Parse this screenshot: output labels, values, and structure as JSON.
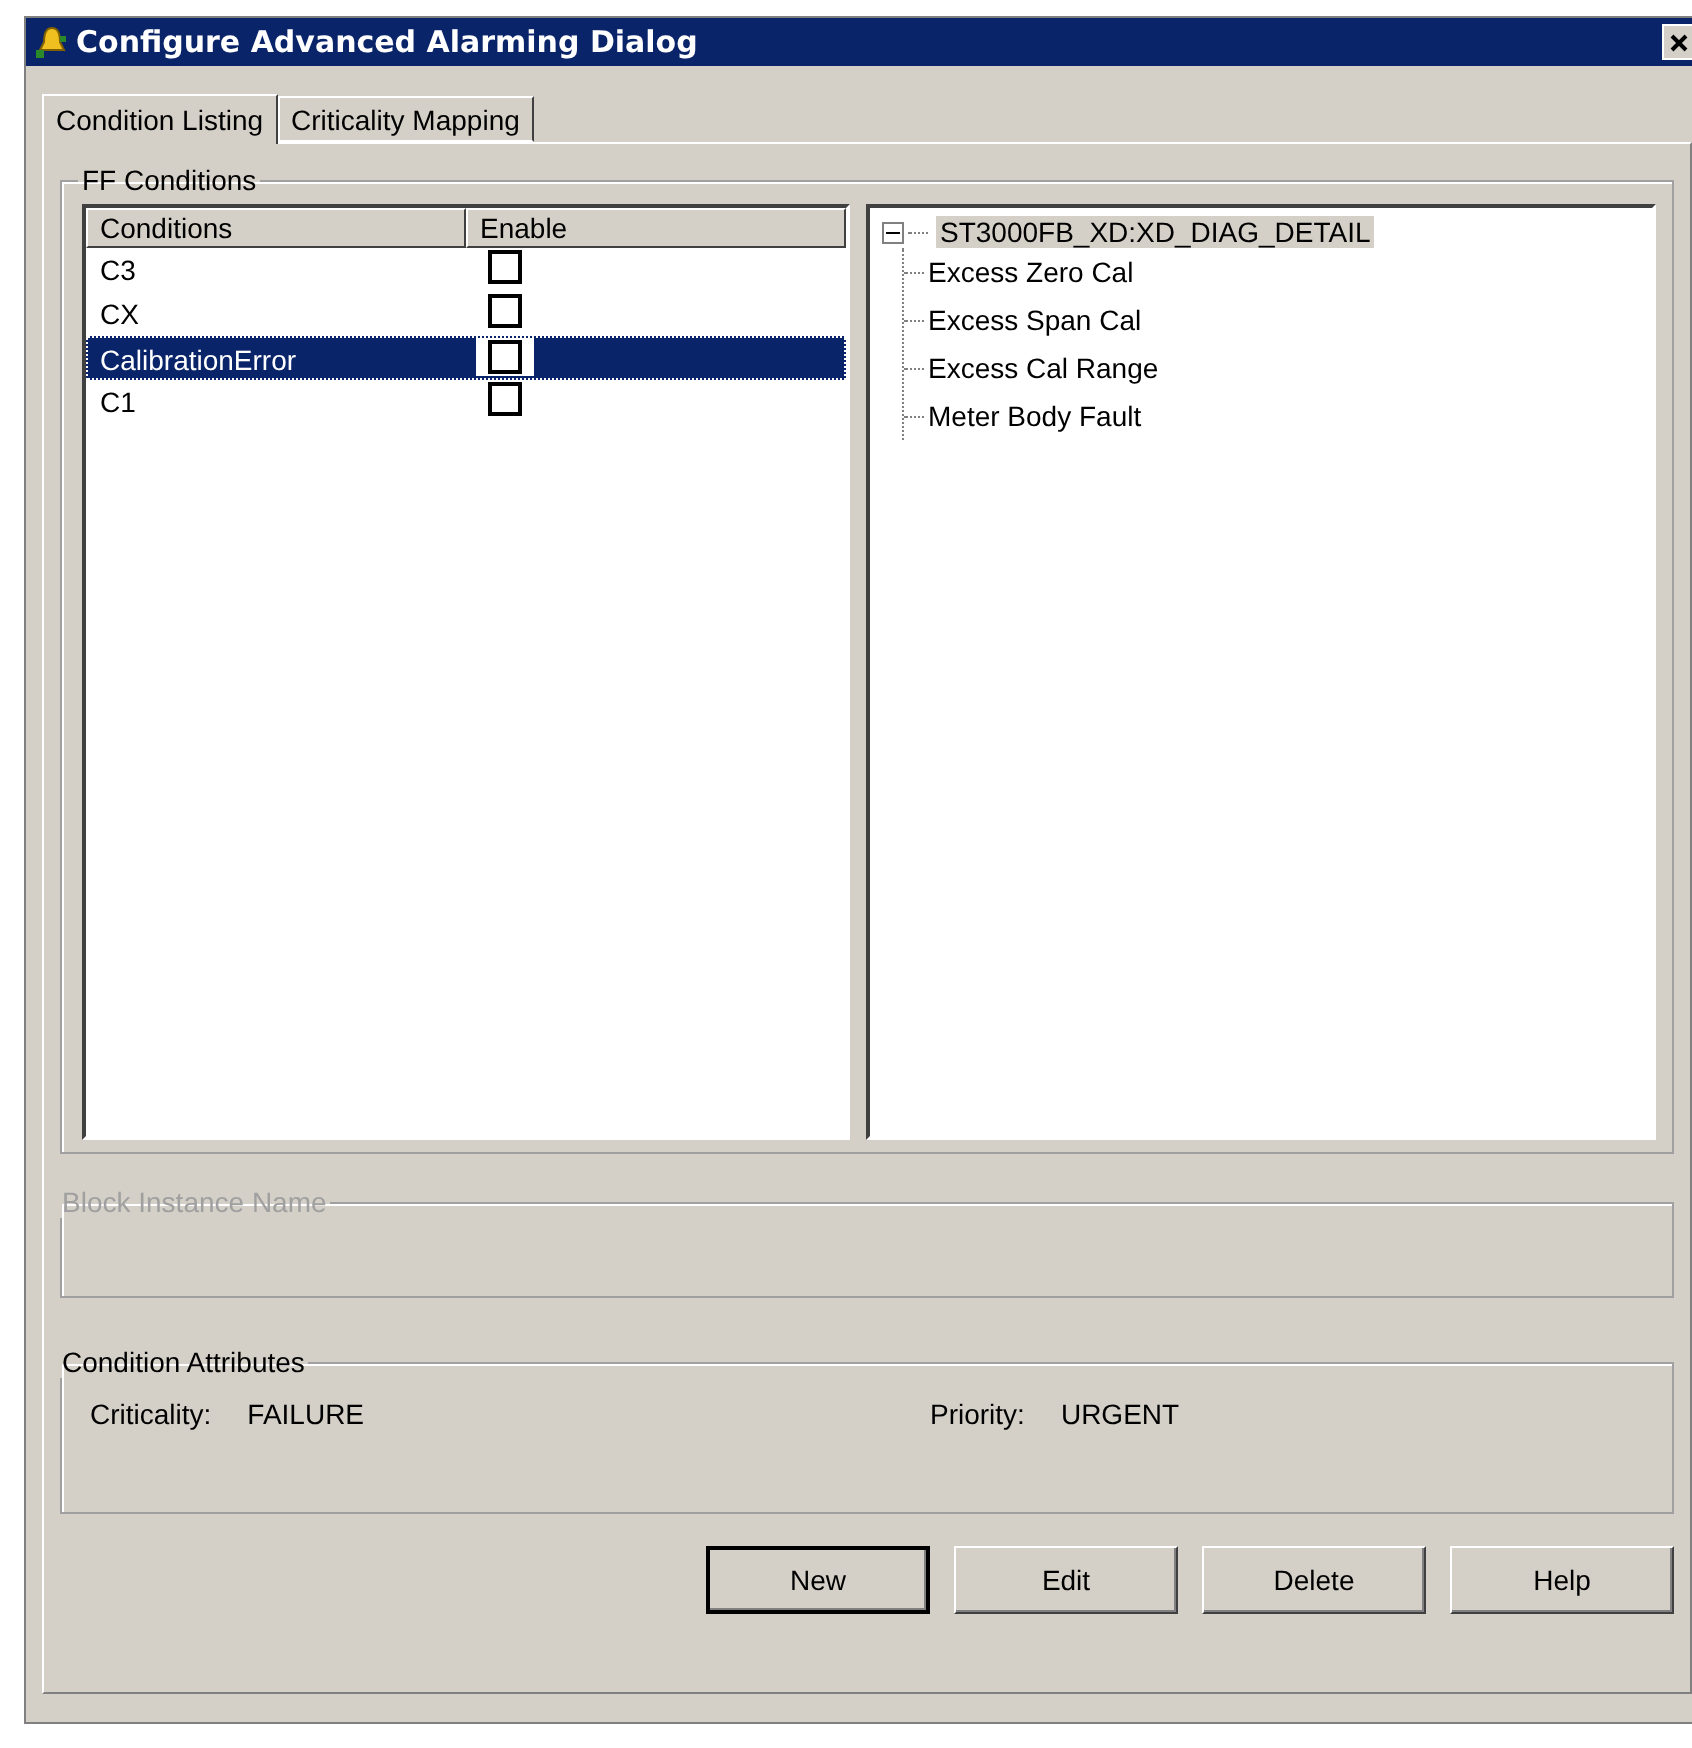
{
  "window": {
    "title": "Configure Advanced Alarming Dialog"
  },
  "tabs": [
    {
      "label": "Condition Listing",
      "selected": true
    },
    {
      "label": "Criticality Mapping",
      "selected": false
    }
  ],
  "ff_conditions": {
    "title": "FF Conditions",
    "columns": [
      "Conditions",
      "Enable"
    ],
    "rows": [
      {
        "name": "C3",
        "enabled": false,
        "selected": false
      },
      {
        "name": "CX",
        "enabled": false,
        "selected": false
      },
      {
        "name": "CalibrationError",
        "enabled": false,
        "selected": true
      },
      {
        "name": "C1",
        "enabled": false,
        "selected": false
      }
    ],
    "tree": {
      "label": "ST3000FB_XD:XD_DIAG_DETAIL",
      "expanded": true,
      "selected": true,
      "children": [
        {
          "label": "Excess Zero Cal"
        },
        {
          "label": "Excess Span Cal"
        },
        {
          "label": "Excess Cal Range"
        },
        {
          "label": "Meter Body Fault"
        }
      ]
    }
  },
  "block_instance": {
    "title": "Block Instance Name",
    "disabled": true
  },
  "condition_attributes": {
    "title": "Condition Attributes",
    "fields": [
      {
        "label": "Criticality:",
        "value": "FAILURE"
      },
      {
        "label": "Priority:",
        "value": "URGENT"
      }
    ]
  },
  "buttons": [
    {
      "label": "New",
      "default": true
    },
    {
      "label": "Edit",
      "default": false
    },
    {
      "label": "Delete",
      "default": false
    },
    {
      "label": "Help",
      "default": false
    }
  ]
}
